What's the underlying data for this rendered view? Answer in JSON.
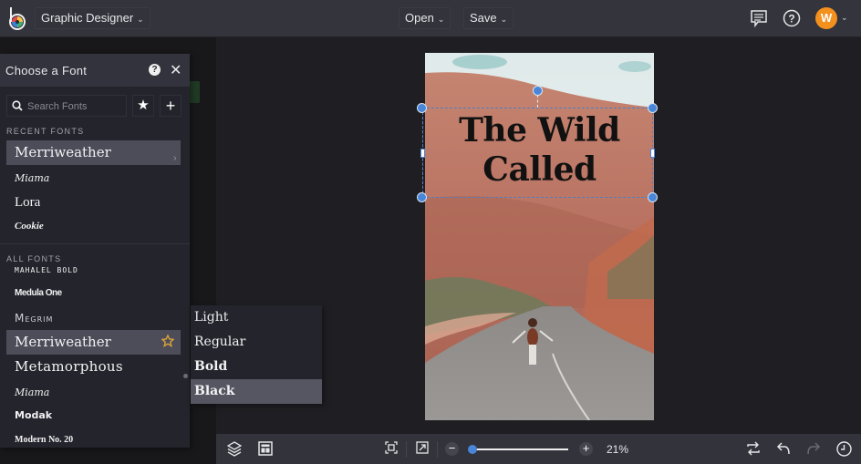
{
  "app": {
    "name": "Graphic Designer",
    "logo": "befunky-logo-icon"
  },
  "topbar": {
    "workspace_label": "Graphic Designer",
    "open_label": "Open",
    "save_label": "Save",
    "chevron": "⌄",
    "icons": [
      "comments-icon",
      "help-icon"
    ],
    "avatar_initial": "W",
    "avatar_color": "#f4901e"
  },
  "font_panel": {
    "title": "Choose a Font",
    "help_glyph": "?",
    "close_glyph": "✕",
    "search_placeholder": "Search Fonts",
    "favorites_glyph": "★",
    "add_glyph": "+",
    "recent_label": "RECENT FONTS",
    "recent_fonts": [
      {
        "name": "Merriweather",
        "selected": true
      },
      {
        "name": "Miama",
        "selected": false
      },
      {
        "name": "Lora",
        "selected": false
      },
      {
        "name": "Cookie",
        "selected": false
      }
    ],
    "all_label": "ALL FONTS",
    "all_fonts": [
      {
        "name": "Mahalel Bold",
        "selected": false
      },
      {
        "name": "Medula One",
        "selected": false
      },
      {
        "name": "Megrim",
        "selected": false
      },
      {
        "name": "Merriweather",
        "selected": true,
        "favorite": true
      },
      {
        "name": "Metamorphous",
        "selected": false
      },
      {
        "name": "Miama",
        "selected": false
      },
      {
        "name": "Modak",
        "selected": false
      },
      {
        "name": "Modern No. 20",
        "selected": false
      }
    ],
    "accent_star_color": "#d9a23a"
  },
  "weight_menu": {
    "items": [
      {
        "label": "Light",
        "selected": false
      },
      {
        "label": "Regular",
        "selected": false
      },
      {
        "label": "Bold",
        "selected": false
      },
      {
        "label": "Black",
        "selected": true
      }
    ]
  },
  "canvas": {
    "headline_line1": "The Wild",
    "headline_line2": "Called",
    "selection_color": "#4a86d8"
  },
  "bottombar": {
    "icons_left": [
      "layers-icon",
      "layout-icon"
    ],
    "icons_mid": [
      "fit-to-screen-icon",
      "actual-size-icon"
    ],
    "zoom_out_glyph": "−",
    "zoom_in_glyph": "+",
    "zoom_percent": "21%",
    "zoom_value": 0.03,
    "icons_right": [
      "swap-icon",
      "undo-icon",
      "redo-icon",
      "history-icon"
    ]
  }
}
